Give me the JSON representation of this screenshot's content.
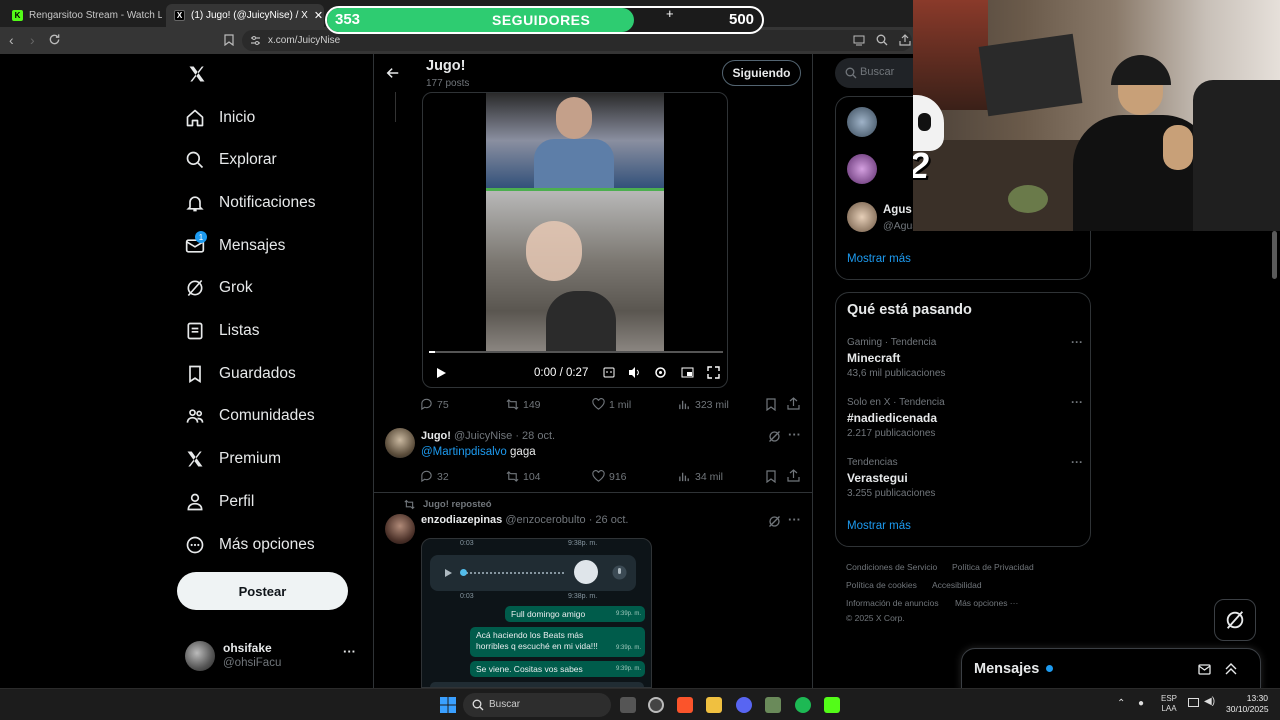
{
  "browser": {
    "tabs": [
      {
        "label": "Rengarsitoo Stream - Watch Live on",
        "active": false
      },
      {
        "label": "(1) Jugo! (@JuicyNise) / X",
        "active": true
      }
    ],
    "new_tab": "+",
    "url": "x.com/JuicyNise"
  },
  "overlay": {
    "followers_current": "353",
    "followers_label": "SEGUIDORES",
    "followers_goal": "500",
    "followers_plus": "+",
    "followers_progress": 0.706,
    "x2_label": "X2"
  },
  "sidebar": {
    "items": [
      {
        "label": "Inicio",
        "icon": "home-icon"
      },
      {
        "label": "Explorar",
        "icon": "search-icon"
      },
      {
        "label": "Notificaciones",
        "icon": "bell-icon"
      },
      {
        "label": "Mensajes",
        "icon": "mail-icon",
        "badge": "1"
      },
      {
        "label": "Grok",
        "icon": "grok-icon"
      },
      {
        "label": "Listas",
        "icon": "list-icon"
      },
      {
        "label": "Guardados",
        "icon": "bookmark-icon"
      },
      {
        "label": "Comunidades",
        "icon": "communities-icon"
      },
      {
        "label": "Premium",
        "icon": "x-icon"
      },
      {
        "label": "Perfil",
        "icon": "person-icon"
      },
      {
        "label": "Más opciones",
        "icon": "more-circle-icon"
      }
    ],
    "post_button": "Postear",
    "account": {
      "name": "ohsifake",
      "handle": "@ohsiFacu",
      "more": "···"
    }
  },
  "profile_header": {
    "name": "Jugo!",
    "posts": "177 posts",
    "follow_button": "Siguiendo"
  },
  "video_post": {
    "time": "0:00 / 0:27",
    "replies": "75",
    "reposts": "149",
    "likes": "1 mil",
    "views": "323 mil"
  },
  "reply_post": {
    "name": "Jugo!",
    "handle": "@JuicyNise",
    "date": "· 28 oct.",
    "mention": "@Martinpdisalvo",
    "text": "gaga",
    "replies": "32",
    "reposts": "104",
    "likes": "916",
    "views": "34 mil"
  },
  "repost": {
    "label": "Jugo! reposteó",
    "name": "enzodiazepinas",
    "handle": "@enzocerobulto",
    "date": "· 26 oct.",
    "chat": {
      "time1": "0:03",
      "time1b": "9:38p. m.",
      "time2": "0:03",
      "time2b": "9:38p. m.",
      "msg1": "Full domingo amigo",
      "msg1_time": "9:39p. m.",
      "msg2": "Acá haciendo los Beats más horribles q escuché en mi vida!!!",
      "msg2_time": "9:39p. m.",
      "msg3": "Se viene. Cositas vos sabes",
      "msg3_time": "9:39p. m."
    }
  },
  "right": {
    "search_placeholder": "Buscar",
    "who_to_follow": [
      {
        "name": "Agus",
        "handle": "@Agus"
      }
    ],
    "show_more_1": "Mostrar más",
    "trends_title": "Qué está pasando",
    "trends": [
      {
        "meta": "Gaming · Tendencia",
        "title": "Minecraft",
        "count": "43,6 mil publicaciones"
      },
      {
        "meta": "Solo en X · Tendencia",
        "title": "#nadiedicenada",
        "count": "2.217 publicaciones"
      },
      {
        "meta": "Tendencias",
        "title": "Verastegui",
        "count": "3.255 publicaciones"
      }
    ],
    "show_more_2": "Mostrar más",
    "footer": [
      "Condiciones de Servicio",
      "Política de Privacidad",
      "Política de cookies",
      "Accesibilidad",
      "Información de anuncios",
      "Más opciones ···",
      "© 2025 X Corp."
    ]
  },
  "messages_drawer": {
    "title": "Mensajes"
  },
  "taskbar": {
    "search": "Buscar",
    "lang": "ESP",
    "lang2": "LAA",
    "time": "13:30",
    "date": "30/10/2025"
  },
  "colors": {
    "accent": "#1d9bf0",
    "progress_green": "#2ecc71"
  }
}
